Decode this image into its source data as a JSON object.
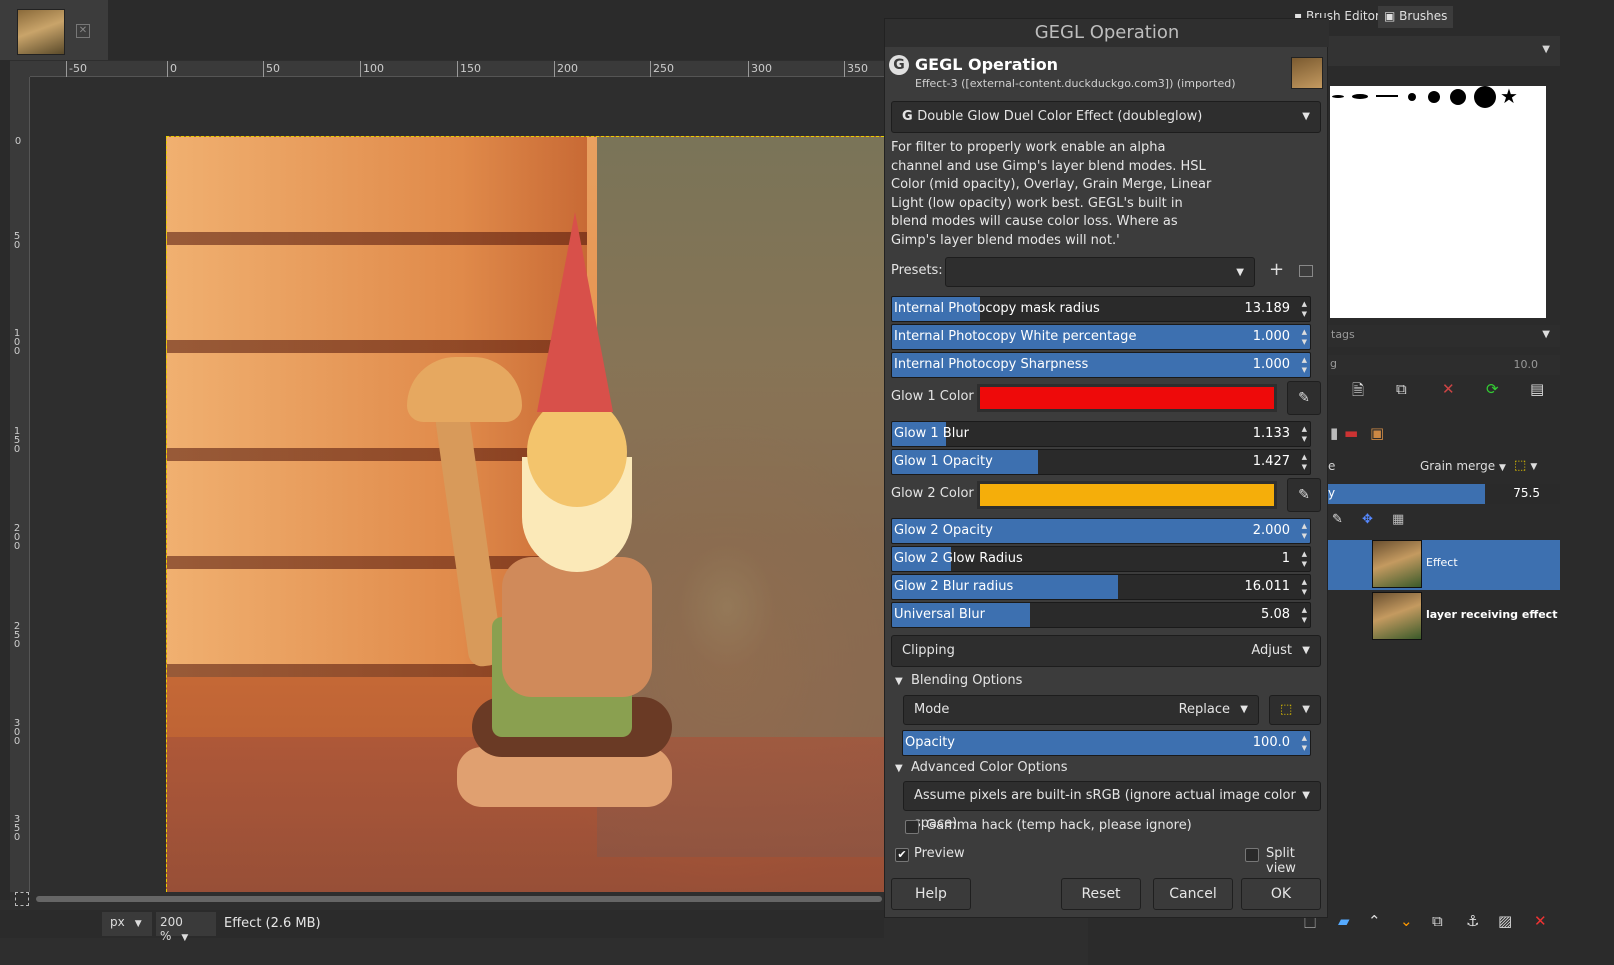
{
  "image_tab": {
    "close_label": "✕"
  },
  "rulers": {
    "horizontal": [
      "-50",
      "0",
      "50",
      "100",
      "150",
      "200",
      "250",
      "300",
      "350"
    ],
    "vertical": [
      "0",
      "50",
      "100",
      "150",
      "200",
      "250",
      "300",
      "350"
    ]
  },
  "statusbar": {
    "unit": "px",
    "zoom": "200 %",
    "info": "Effect (2.6 MB)"
  },
  "dialog": {
    "window_title": "GEGL Operation",
    "header_title": "GEGL Operation",
    "header_subtitle": "Effect-3 ([external-content.duckduckgo.com3]) (imported)",
    "operation": "Double Glow Duel Color Effect (doubleglow)",
    "description": "For filter to properly work enable an alpha channel and use Gimp's layer blend modes. HSL Color (mid opacity),  Overlay, Grain Merge, Linear Light (low opacity) work best. GEGL's built in blend modes will cause color loss. Where as Gimp's layer blend modes will not.'",
    "presets_label": "Presets:",
    "presets_value": "",
    "sliders": [
      {
        "label": "Internal Photocopy mask radius",
        "value": "13.189",
        "fill": 0.21
      },
      {
        "label": "Internal Photocopy White percentage",
        "value": "1.000",
        "fill": 1.0
      },
      {
        "label": "Internal Photocopy Sharpness",
        "value": "1.000",
        "fill": 1.0
      }
    ],
    "glow1_color_label": "Glow 1 Color",
    "glow1_color": "#ee0a0a",
    "sliders2": [
      {
        "label": "Glow 1 Blur",
        "value": "1.133",
        "fill": 0.13
      },
      {
        "label": "Glow 1 Opacity",
        "value": "1.427",
        "fill": 0.35
      }
    ],
    "glow2_color_label": "Glow 2 Color",
    "glow2_color": "#f5ae0a",
    "sliders3": [
      {
        "label": "Glow 2 Opacity",
        "value": "2.000",
        "fill": 1.0
      },
      {
        "label": "Glow 2 Glow Radius",
        "value": "1",
        "fill": 0.14
      },
      {
        "label": "Glow 2 Blur radius",
        "value": "16.011",
        "fill": 0.54
      },
      {
        "label": "Universal Blur",
        "value": "5.08",
        "fill": 0.33
      }
    ],
    "clipping_label": "Clipping",
    "clipping_value": "Adjust",
    "blending_label": "Blending Options",
    "mode_label": "Mode",
    "mode_value": "Replace",
    "opacity_label": "Opacity",
    "opacity_value": "100.0",
    "advanced_label": "Advanced Color Options",
    "color_space": "Assume pixels are built-in sRGB (ignore actual image color space)",
    "gamma_label": "Gamma hack (temp hack, please ignore)",
    "preview_label": "Preview",
    "split_label": "Split view",
    "help": "Help",
    "reset": "Reset",
    "cancel": "Cancel",
    "ok": "OK"
  },
  "right_panel": {
    "tab_brush_editor": "Brush Editor",
    "tab_brushes": "Brushes",
    "tags_placeholder": "tags",
    "spacing_label": "g",
    "spacing_value": "10.0",
    "layer_mode": "Grain merge",
    "layer_mode_prefix": "e",
    "layer_opacity_label": "y",
    "layer_opacity": "75.5",
    "layers": [
      {
        "name": "Effect",
        "selected": true
      },
      {
        "name": "layer receiving effect",
        "selected": false
      }
    ]
  }
}
